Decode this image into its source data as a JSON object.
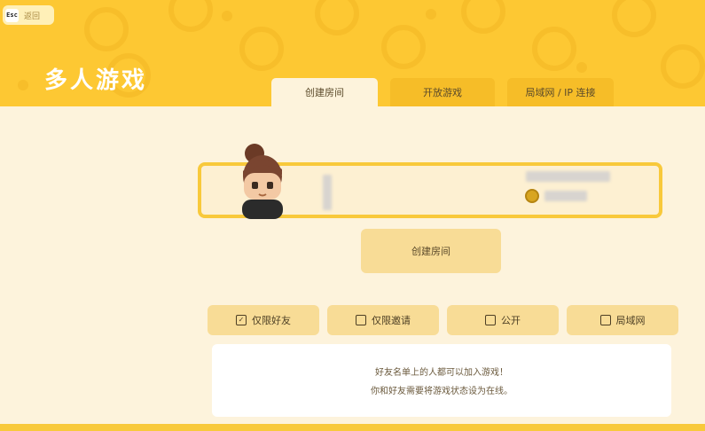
{
  "header": {
    "back_icon_text": "Esc",
    "back_label": "返回",
    "title": "多人游戏"
  },
  "tabs": [
    {
      "label": "创建房间",
      "active": true
    },
    {
      "label": "开放游戏",
      "active": false
    },
    {
      "label": "局域网 / IP 连接",
      "active": false
    }
  ],
  "player_card": {
    "name": "",
    "currency": ""
  },
  "create_room_button": "创建房间",
  "options": [
    {
      "label": "仅限好友",
      "checked": true
    },
    {
      "label": "仅限邀请",
      "checked": false
    },
    {
      "label": "公开",
      "checked": false
    },
    {
      "label": "局域网",
      "checked": false
    }
  ],
  "info": {
    "line1": "好友名单上的人都可以加入游戏！",
    "line2": "你和好友需要将游戏状态设为在线。"
  },
  "colors": {
    "header_bg": "#fdc833",
    "page_bg": "#fdf3dc",
    "button_bg": "#f8dc96",
    "card_border": "#f8c93b"
  }
}
